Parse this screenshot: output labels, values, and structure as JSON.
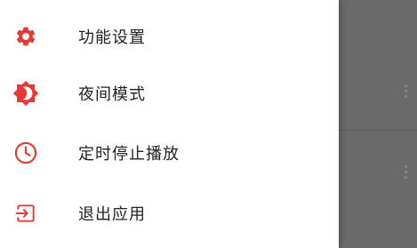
{
  "accent_color": "#e53935",
  "drawer": {
    "items": [
      {
        "label": "功能设置",
        "icon": "gear-icon"
      },
      {
        "label": "夜间模式",
        "icon": "brightness-icon"
      },
      {
        "label": "定时停止播放",
        "icon": "clock-icon"
      },
      {
        "label": "退出应用",
        "icon": "exit-icon"
      }
    ]
  }
}
